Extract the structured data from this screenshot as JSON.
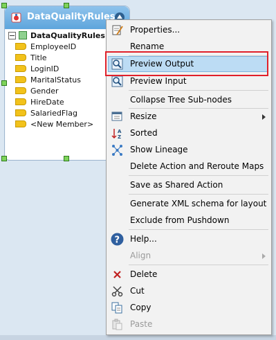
{
  "component": {
    "title": "DataQualityRules",
    "root_label": "DataQualityRules",
    "fields": [
      "EmployeeID",
      "Title",
      "LoginID",
      "MaritalStatus",
      "Gender",
      "HireDate",
      "SalariedFlag",
      "<New Member>"
    ]
  },
  "menu": {
    "items": [
      {
        "label": "Properties...",
        "icon": "properties-icon"
      },
      {
        "label": "Rename",
        "icon": ""
      },
      {
        "label": "Preview Output",
        "icon": "preview-output-icon",
        "highlighted": true
      },
      {
        "label": "Preview Input",
        "icon": "preview-input-icon"
      },
      {
        "label": "Collapse Tree Sub-nodes",
        "icon": ""
      },
      {
        "label": "Resize",
        "icon": "resize-icon",
        "submenu": true
      },
      {
        "label": "Sorted",
        "icon": "sort-icon"
      },
      {
        "label": "Show Lineage",
        "icon": "lineage-icon"
      },
      {
        "label": "Delete Action and Reroute Maps",
        "icon": ""
      },
      {
        "label": "Save as Shared Action",
        "icon": ""
      },
      {
        "label": "Generate XML schema for layout",
        "icon": ""
      },
      {
        "label": "Exclude from Pushdown",
        "icon": ""
      },
      {
        "label": "Help...",
        "icon": "help-icon"
      },
      {
        "label": "Align",
        "icon": "",
        "disabled": true,
        "submenu": true
      },
      {
        "label": "Delete",
        "icon": "delete-icon"
      },
      {
        "label": "Cut",
        "icon": "cut-icon"
      },
      {
        "label": "Copy",
        "icon": "copy-icon"
      },
      {
        "label": "Paste",
        "icon": "paste-icon",
        "disabled": true
      }
    ]
  },
  "colors": {
    "highlight": "#bcdcf4",
    "annotation_box": "#e0202a",
    "header": "#5ea5dc"
  }
}
